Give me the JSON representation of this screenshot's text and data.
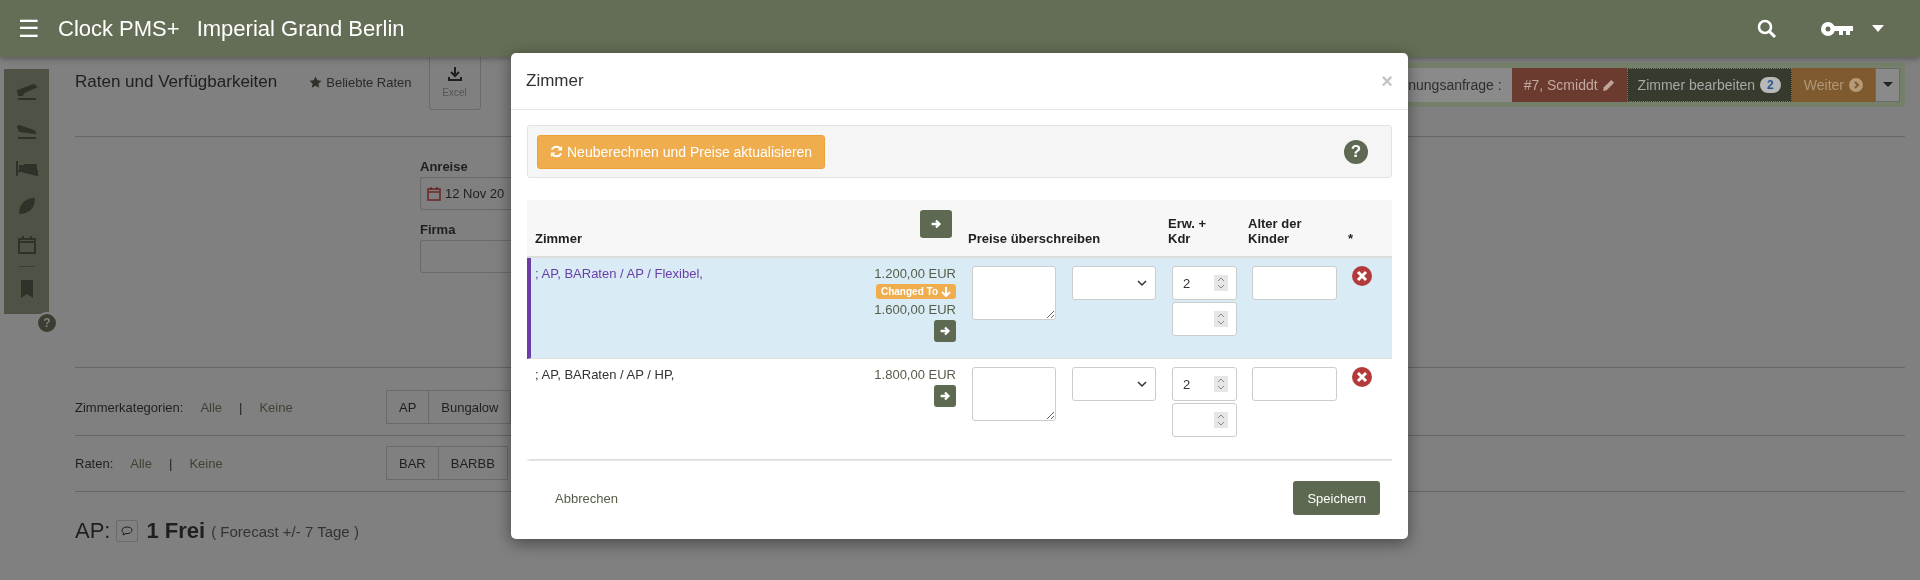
{
  "app": {
    "menu_icon": "☰",
    "title": "Clock PMS+",
    "hotel": "Imperial Grand Berlin"
  },
  "sidebar": {
    "help": "?"
  },
  "page": {
    "title": "Raten und Verfügbarkeiten",
    "favorites": "Beliebte Raten",
    "export": "Excel",
    "arrival_label": "Anreise",
    "arrival_date": "12 Nov 20",
    "company_label": "Firma",
    "categories": {
      "label": "Zimmerkategorien:",
      "all": "Alle",
      "separator": "|",
      "none": "Keine",
      "options": [
        "AP",
        "Bungalow"
      ]
    },
    "rates": {
      "label": "Raten:",
      "all": "Alle",
      "separator": "|",
      "none": "Keine",
      "options": [
        "BAR",
        "BARBB"
      ]
    },
    "availability": {
      "category": "AP:",
      "free": "1 Frei",
      "forecast": "( Forecast +/- 7 Tage )"
    }
  },
  "booking_bar": {
    "label": "nungsanfrage :",
    "guest": "#7, Scmiddt",
    "edit_rooms": "Zimmer bearbeiten",
    "room_count": "2",
    "next": "Weiter"
  },
  "modal": {
    "title": "Zimmer",
    "close": "×",
    "recalculate": "Neuberechnen und Preise aktualisieren",
    "help": "?",
    "columns": [
      "Zimmer",
      "Preise überschreiben",
      "Erw. + Kdr",
      "Alter der Kinder",
      "*"
    ],
    "rows": [
      {
        "name": "; AP, BARaten / AP / Flexibel,",
        "selected": true,
        "price": "1.200,00 EUR",
        "badge": "Changed To",
        "new_price": "1.600,00 EUR",
        "adults": "2"
      },
      {
        "name": "; AP, BARaten / AP / HP,",
        "selected": false,
        "price": "1.800,00 EUR",
        "adults": "2"
      }
    ],
    "cancel": "Abbrechen",
    "save": "Speichern"
  }
}
